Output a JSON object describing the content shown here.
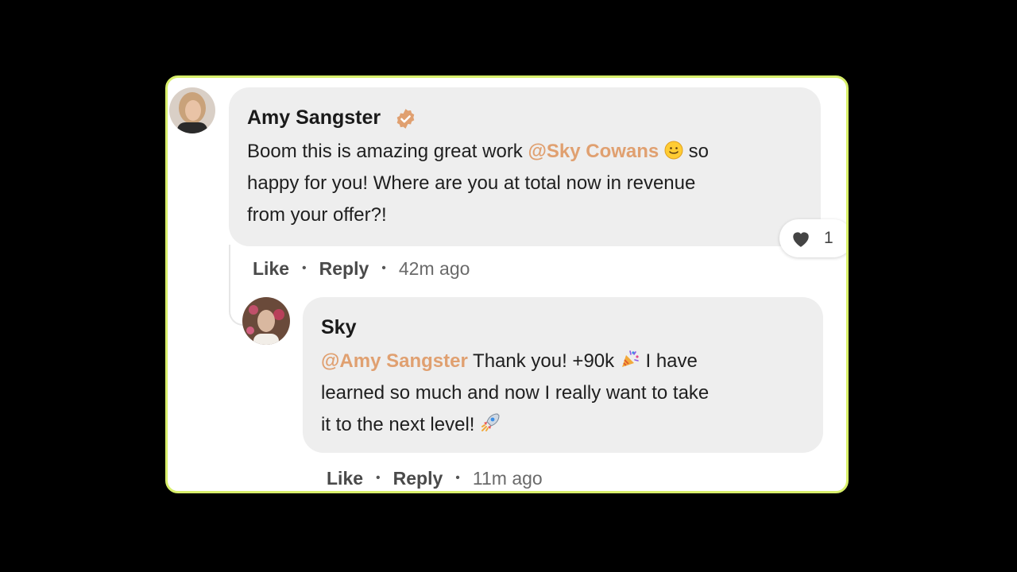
{
  "comments": [
    {
      "author": "Amy Sangster",
      "verified": true,
      "mention": "@Sky Cowans",
      "text_before": "Boom this is amazing great work ",
      "text_line1_end": " so",
      "text_line2": "happy for you! Where are you at total now in revenue",
      "text_line3": "from your offer?!",
      "emoji": "slightly-smiling-face",
      "like_label": "Like",
      "reply_label": "Reply",
      "time": "42m ago",
      "reaction": {
        "icon": "heart-icon",
        "count": "1"
      }
    },
    {
      "author": "Sky",
      "mention": "@Amy Sangster",
      "text_line1": " Thank you! +90k ",
      "text_line1_end": " I have",
      "text_line2": "learned so much and now I really want to take",
      "text_line3": "it to the next level! ",
      "emoji1": "party-popper",
      "emoji2": "rocket",
      "like_label": "Like",
      "reply_label": "Reply",
      "time": "11m ago"
    }
  ],
  "colors": {
    "mention": "#e0a070",
    "border": "#d8ef6a",
    "bubble": "#eeeeee",
    "verified": "#e0a070"
  }
}
